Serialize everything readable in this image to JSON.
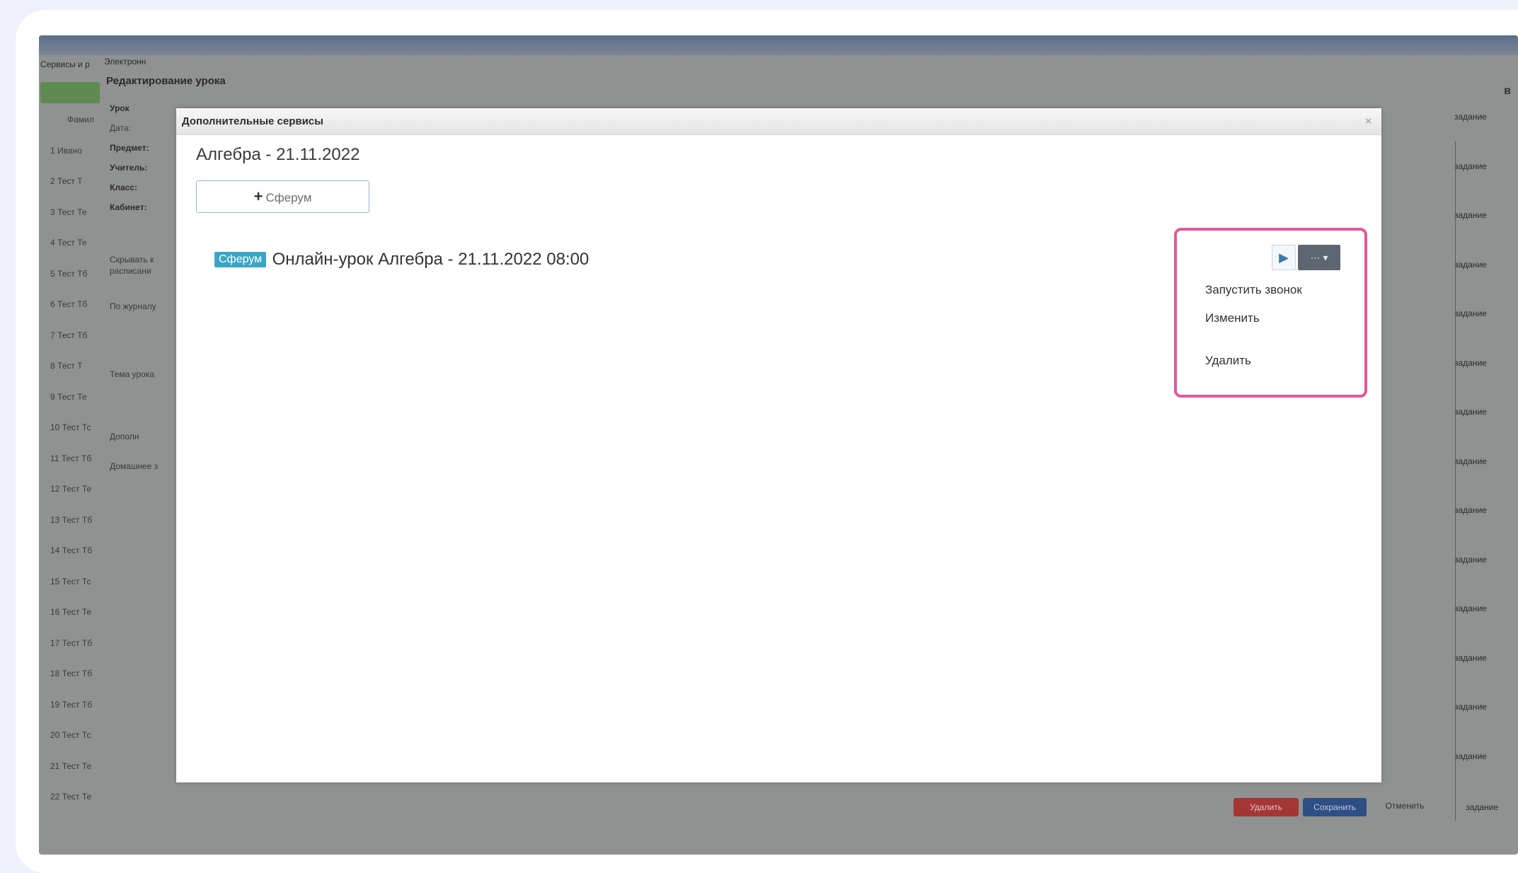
{
  "background": {
    "header_left": "Сервисы и р",
    "header_left_2": "Электронн",
    "page_title": "Редактирование урока",
    "corner_label": "в",
    "list_header": "Фамил",
    "rows": [
      "Ивано",
      "Тест Т",
      "Тест Те",
      "Тест Те",
      "Тест Тб",
      "Тест Тб",
      "Тест Тб",
      "Тест Т",
      "Тест Те",
      "Тест Тс",
      "Тест Тб",
      "Тест Те",
      "Тест Тб",
      "Тест Тб",
      "Тест Тс",
      "Тест Те",
      "Тест Тб",
      "Тест Тб",
      "Тест Тб",
      "Тест Тс",
      "Тест Те",
      "Тест Те"
    ],
    "row_numbers": [
      "1",
      "2",
      "3",
      "4",
      "5",
      "6",
      "7",
      "8",
      "9",
      "10",
      "11",
      "12",
      "13",
      "14",
      "15",
      "16",
      "17",
      "18",
      "19",
      "20",
      "21",
      "22"
    ],
    "form_items": [
      "Урок",
      "Дата:",
      "Предмет:",
      "Учитель:",
      "Класс:",
      "Кабинет:"
    ],
    "form_extra": [
      "Скрывать к",
      "расписани",
      "По журналу",
      "Тема урока",
      "Дополн",
      "Домашнее з"
    ],
    "right_items": [
      "задание",
      "задание",
      "задание",
      "задание",
      "задание",
      "задание",
      "задание",
      "задание",
      "задание",
      "задание",
      "задание",
      "задание",
      "задание",
      "задание"
    ],
    "btn_delete": "Удалить",
    "btn_save": "Сохранить",
    "btn_cancel": "Отменить",
    "right_bottom": "задание"
  },
  "modal": {
    "title": "Дополнительные сервисы",
    "close": "×",
    "subject": "Алгебра - 21.11.2022",
    "add_button": "Сферум",
    "add_icon": "plus-icon",
    "event": {
      "badge": "Сферум",
      "title": "Онлайн-урок Алгебра - 21.11.2022 08:00"
    },
    "play_icon": "play-icon",
    "more_label": "⋯ ▾",
    "menu": {
      "start_call": "Запустить звонок",
      "edit": "Изменить",
      "delete": "Удалить"
    }
  },
  "colors": {
    "highlight": "#e6559b",
    "badge": "#3aa6c6",
    "overlay": "#8f9290"
  }
}
